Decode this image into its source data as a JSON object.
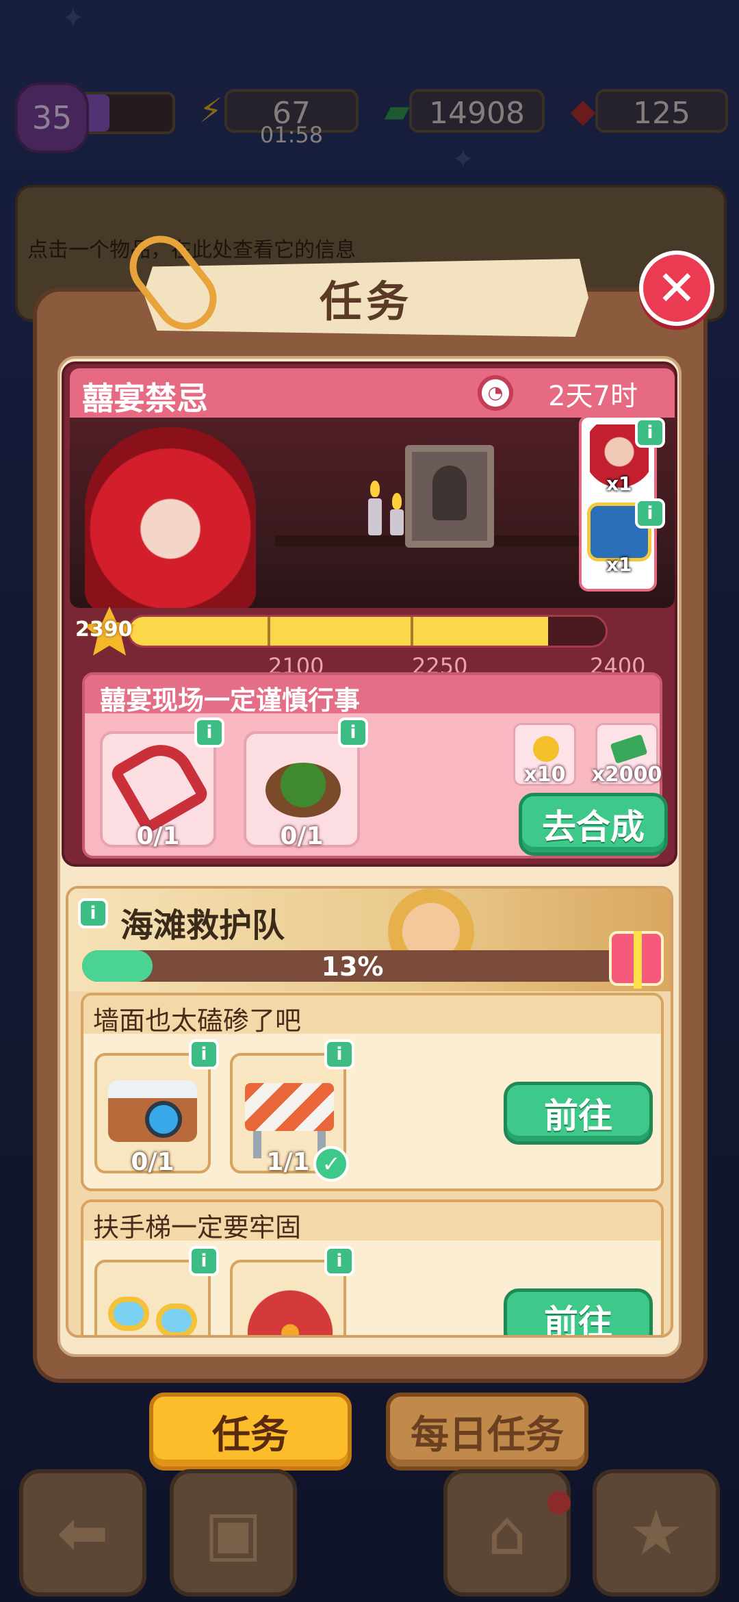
{
  "status": {
    "level": "35",
    "energy": "67",
    "energy_timer": "01:58",
    "cash": "14908",
    "gems": "125"
  },
  "hint": {
    "text": "点击一个物品，在此处查看它的信息"
  },
  "panel": {
    "title": "任务",
    "close_label": "✕"
  },
  "event": {
    "title": "囍宴禁忌",
    "timer": "2天7时",
    "rewards": [
      {
        "icon": "bride-avatar-icon",
        "qty": "x1"
      },
      {
        "icon": "treasure-chest-icon",
        "qty": "x1"
      }
    ],
    "progress": {
      "current": "2390",
      "value": 2390,
      "min": 1950,
      "max": 2450,
      "ticks": [
        "2100",
        "2250",
        "2400"
      ]
    },
    "task": {
      "title": "囍宴现场一定谨慎行事",
      "items": [
        {
          "icon": "chainsaw-icon",
          "count": "0/1"
        },
        {
          "icon": "bush-icon",
          "count": "0/1"
        }
      ],
      "rewards": [
        {
          "icon": "star-coin-icon",
          "qty": "x10"
        },
        {
          "icon": "cash-stack-icon",
          "qty": "x2000"
        }
      ],
      "button": "去合成"
    }
  },
  "beach": {
    "title": "海滩救护队",
    "progress_label": "13%",
    "progress": 0.13,
    "tasks": [
      {
        "title": "墙面也太磕碜了吧",
        "items": [
          {
            "icon": "camera-icon",
            "count": "0/1",
            "done": false
          },
          {
            "icon": "road-barrier-icon",
            "count": "1/1",
            "done": true
          }
        ],
        "button": "前往"
      },
      {
        "title": "扶手梯一定要牢固",
        "items": [
          {
            "icon": "sunglasses-icon",
            "count": ""
          },
          {
            "icon": "red-coral-icon",
            "count": ""
          }
        ],
        "button": "前往"
      }
    ]
  },
  "tabs": {
    "tasks": "任务",
    "daily": "每日任务"
  },
  "nav": {
    "back_icon": "back-arrow-icon",
    "bag_icon": "backpack-icon",
    "shop_icon": "basket-icon",
    "quest_icon": "clipboard-star-icon"
  },
  "colors": {
    "accent_green": "#3ec98a",
    "event_pink": "#e66a82",
    "tab_active": "#fbbd2a",
    "close_red": "#ea3b52"
  }
}
